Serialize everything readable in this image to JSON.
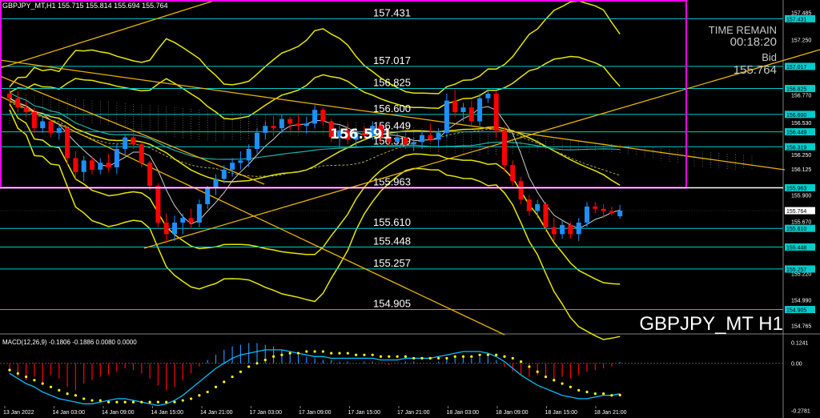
{
  "header": {
    "symbol_line": "GBPJPY_MT,H1  155.715 155.814 155.694 155.764"
  },
  "info": {
    "time_remain_label": "TIME REMAIN",
    "time_remain_value": "00:18:20",
    "bid_label": "Bid",
    "bid_value": "155.764",
    "watermark": "GBPJPY_MT H1",
    "center_price_tag": "156.591"
  },
  "colors": {
    "background": "#000000",
    "bull_candle": "#1e90ff",
    "bear_candle": "#ff0000",
    "level_line": "#00cccc",
    "trend_line": "#e8b400",
    "bollinger": "#e6e600",
    "box": "#ff00ff",
    "macd_line": "#00bfff",
    "macd_signal": "#ffff00"
  },
  "chart_data": [
    {
      "type": "candlestick",
      "instrument": "GBPJPY_MT",
      "timeframe": "H1",
      "ylim": [
        154.7,
        157.58
      ],
      "y_ticks": [
        "157.485",
        "157.250",
        "157.010",
        "156.770",
        "156.530",
        "156.250",
        "156.125",
        "155.900",
        "155.670",
        "155.440",
        "155.220",
        "154.990",
        "154.765"
      ],
      "x_ticks": [
        "13 Jan 2022",
        "14 Jan 03:00",
        "14 Jan 09:00",
        "14 Jan 15:00",
        "14 Jan 21:00",
        "17 Jan 03:00",
        "17 Jan 09:00",
        "17 Jan 15:00",
        "17 Jan 21:00",
        "18 Jan 03:00",
        "18 Jan 09:00",
        "18 Jan 15:00",
        "18 Jan 21:00"
      ],
      "levels": [
        157.431,
        157.017,
        156.825,
        156.6,
        156.449,
        156.319,
        155.963,
        155.61,
        155.448,
        155.257,
        154.905
      ],
      "level_labels": [
        "157.431",
        "157.017",
        "156.825",
        "156.600",
        "156.449",
        "156.319",
        "155.963",
        "155.610",
        "155.448",
        "155.257",
        "154.905"
      ],
      "level_tags": [
        "157.431",
        "157.017",
        "156.825",
        "156.600",
        "156.449",
        "156.319",
        "155.963",
        "155.610",
        "155.448",
        "155.257",
        "154.905"
      ],
      "current_price": 155.764,
      "current_price_tag": "155.764",
      "candles": [
        {
          "o": 156.78,
          "h": 156.84,
          "l": 156.7,
          "c": 156.74
        },
        {
          "o": 156.74,
          "h": 156.8,
          "l": 156.62,
          "c": 156.66
        },
        {
          "o": 156.66,
          "h": 156.72,
          "l": 156.58,
          "c": 156.62
        },
        {
          "o": 156.62,
          "h": 156.66,
          "l": 156.44,
          "c": 156.48
        },
        {
          "o": 156.48,
          "h": 156.58,
          "l": 156.44,
          "c": 156.54
        },
        {
          "o": 156.54,
          "h": 156.56,
          "l": 156.4,
          "c": 156.44
        },
        {
          "o": 156.44,
          "h": 156.52,
          "l": 156.38,
          "c": 156.48
        },
        {
          "o": 156.48,
          "h": 156.5,
          "l": 156.16,
          "c": 156.22
        },
        {
          "o": 156.22,
          "h": 156.28,
          "l": 156.04,
          "c": 156.1
        },
        {
          "o": 156.1,
          "h": 156.24,
          "l": 156.02,
          "c": 156.2
        },
        {
          "o": 156.2,
          "h": 156.24,
          "l": 156.08,
          "c": 156.12
        },
        {
          "o": 156.12,
          "h": 156.22,
          "l": 156.08,
          "c": 156.18
        },
        {
          "o": 156.18,
          "h": 156.26,
          "l": 156.1,
          "c": 156.14
        },
        {
          "o": 156.14,
          "h": 156.34,
          "l": 156.08,
          "c": 156.3
        },
        {
          "o": 156.3,
          "h": 156.42,
          "l": 156.24,
          "c": 156.4
        },
        {
          "o": 156.4,
          "h": 156.44,
          "l": 156.3,
          "c": 156.34
        },
        {
          "o": 156.34,
          "h": 156.36,
          "l": 156.14,
          "c": 156.18
        },
        {
          "o": 156.18,
          "h": 156.2,
          "l": 155.94,
          "c": 155.98
        },
        {
          "o": 155.98,
          "h": 156.0,
          "l": 155.62,
          "c": 155.66
        },
        {
          "o": 155.66,
          "h": 155.74,
          "l": 155.48,
          "c": 155.56
        },
        {
          "o": 155.56,
          "h": 155.72,
          "l": 155.5,
          "c": 155.66
        },
        {
          "o": 155.66,
          "h": 155.74,
          "l": 155.56,
          "c": 155.7
        },
        {
          "o": 155.7,
          "h": 155.78,
          "l": 155.6,
          "c": 155.66
        },
        {
          "o": 155.66,
          "h": 155.86,
          "l": 155.62,
          "c": 155.82
        },
        {
          "o": 155.82,
          "h": 155.98,
          "l": 155.78,
          "c": 155.96
        },
        {
          "o": 155.96,
          "h": 156.08,
          "l": 155.9,
          "c": 156.04
        },
        {
          "o": 156.04,
          "h": 156.16,
          "l": 156.0,
          "c": 156.12
        },
        {
          "o": 156.12,
          "h": 156.22,
          "l": 156.06,
          "c": 156.18
        },
        {
          "o": 156.18,
          "h": 156.28,
          "l": 156.12,
          "c": 156.2
        },
        {
          "o": 156.2,
          "h": 156.34,
          "l": 156.14,
          "c": 156.3
        },
        {
          "o": 156.3,
          "h": 156.48,
          "l": 156.26,
          "c": 156.44
        },
        {
          "o": 156.44,
          "h": 156.54,
          "l": 156.38,
          "c": 156.5
        },
        {
          "o": 156.5,
          "h": 156.58,
          "l": 156.42,
          "c": 156.48
        },
        {
          "o": 156.48,
          "h": 156.6,
          "l": 156.44,
          "c": 156.56
        },
        {
          "o": 156.56,
          "h": 156.58,
          "l": 156.46,
          "c": 156.52
        },
        {
          "o": 156.52,
          "h": 156.6,
          "l": 156.46,
          "c": 156.5
        },
        {
          "o": 156.5,
          "h": 156.58,
          "l": 156.44,
          "c": 156.52
        },
        {
          "o": 156.52,
          "h": 156.68,
          "l": 156.48,
          "c": 156.64
        },
        {
          "o": 156.64,
          "h": 156.66,
          "l": 156.5,
          "c": 156.54
        },
        {
          "o": 156.54,
          "h": 156.56,
          "l": 156.36,
          "c": 156.4
        },
        {
          "o": 156.4,
          "h": 156.5,
          "l": 156.32,
          "c": 156.46
        },
        {
          "o": 156.46,
          "h": 156.52,
          "l": 156.34,
          "c": 156.38
        },
        {
          "o": 156.38,
          "h": 156.48,
          "l": 156.32,
          "c": 156.44
        },
        {
          "o": 156.44,
          "h": 156.5,
          "l": 156.38,
          "c": 156.42
        },
        {
          "o": 156.42,
          "h": 156.54,
          "l": 156.38,
          "c": 156.5
        },
        {
          "o": 156.5,
          "h": 156.52,
          "l": 156.36,
          "c": 156.4
        },
        {
          "o": 156.4,
          "h": 156.46,
          "l": 156.32,
          "c": 156.36
        },
        {
          "o": 156.36,
          "h": 156.44,
          "l": 156.32,
          "c": 156.4
        },
        {
          "o": 156.4,
          "h": 156.44,
          "l": 156.3,
          "c": 156.34
        },
        {
          "o": 156.34,
          "h": 156.4,
          "l": 156.28,
          "c": 156.36
        },
        {
          "o": 156.36,
          "h": 156.46,
          "l": 156.3,
          "c": 156.42
        },
        {
          "o": 156.42,
          "h": 156.52,
          "l": 156.36,
          "c": 156.38
        },
        {
          "o": 156.38,
          "h": 156.48,
          "l": 156.32,
          "c": 156.44
        },
        {
          "o": 156.44,
          "h": 156.78,
          "l": 156.4,
          "c": 156.72
        },
        {
          "o": 156.72,
          "h": 156.82,
          "l": 156.58,
          "c": 156.62
        },
        {
          "o": 156.62,
          "h": 156.7,
          "l": 156.54,
          "c": 156.66
        },
        {
          "o": 156.66,
          "h": 156.72,
          "l": 156.5,
          "c": 156.54
        },
        {
          "o": 156.54,
          "h": 156.78,
          "l": 156.5,
          "c": 156.74
        },
        {
          "o": 156.74,
          "h": 156.82,
          "l": 156.7,
          "c": 156.78
        },
        {
          "o": 156.78,
          "h": 156.8,
          "l": 156.4,
          "c": 156.46
        },
        {
          "o": 156.46,
          "h": 156.5,
          "l": 156.1,
          "c": 156.16
        },
        {
          "o": 156.16,
          "h": 156.2,
          "l": 155.98,
          "c": 156.02
        },
        {
          "o": 156.02,
          "h": 156.06,
          "l": 155.82,
          "c": 155.86
        },
        {
          "o": 155.86,
          "h": 155.9,
          "l": 155.72,
          "c": 155.76
        },
        {
          "o": 155.76,
          "h": 155.86,
          "l": 155.7,
          "c": 155.82
        },
        {
          "o": 155.82,
          "h": 155.84,
          "l": 155.58,
          "c": 155.62
        },
        {
          "o": 155.62,
          "h": 155.7,
          "l": 155.5,
          "c": 155.56
        },
        {
          "o": 155.56,
          "h": 155.68,
          "l": 155.52,
          "c": 155.64
        },
        {
          "o": 155.64,
          "h": 155.66,
          "l": 155.52,
          "c": 155.56
        },
        {
          "o": 155.56,
          "h": 155.7,
          "l": 155.5,
          "c": 155.66
        },
        {
          "o": 155.66,
          "h": 155.84,
          "l": 155.62,
          "c": 155.8
        },
        {
          "o": 155.8,
          "h": 155.84,
          "l": 155.74,
          "c": 155.78
        },
        {
          "o": 155.78,
          "h": 155.82,
          "l": 155.7,
          "c": 155.76
        },
        {
          "o": 155.76,
          "h": 155.8,
          "l": 155.72,
          "c": 155.74
        },
        {
          "o": 155.715,
          "h": 155.814,
          "l": 155.694,
          "c": 155.764
        }
      ]
    },
    {
      "type": "bar",
      "indicator": "MACD(12,26,9)",
      "header": "MACD(12,26,9) -0.1806 -0.1886 0.0080 0.0000",
      "ylim": [
        -0.31,
        0.16
      ],
      "y_ticks": [
        "0.1241",
        "0.00",
        "-0.2781"
      ],
      "histogram": [
        -0.05,
        -0.08,
        -0.1,
        -0.08,
        -0.12,
        -0.07,
        -0.09,
        -0.14,
        -0.16,
        -0.12,
        -0.1,
        -0.08,
        -0.07,
        -0.05,
        -0.03,
        -0.04,
        -0.06,
        -0.09,
        -0.13,
        -0.16,
        -0.14,
        -0.1,
        -0.06,
        -0.02,
        0.02,
        0.05,
        0.08,
        0.1,
        0.11,
        0.12,
        0.12,
        0.11,
        0.1,
        0.08,
        0.07,
        0.05,
        0.04,
        0.03,
        0.02,
        0.02,
        0.01,
        0.01,
        0.0,
        0.01,
        0.01,
        0.0,
        -0.01,
        0.0,
        0.01,
        0.01,
        0.0,
        0.0,
        0.01,
        0.03,
        0.04,
        0.04,
        0.03,
        0.04,
        0.04,
        0.02,
        -0.02,
        -0.05,
        -0.07,
        -0.08,
        -0.07,
        -0.09,
        -0.1,
        -0.08,
        -0.09,
        -0.07,
        -0.05,
        -0.04,
        -0.03,
        -0.02,
        0.008
      ],
      "macd": [
        -0.06,
        -0.09,
        -0.12,
        -0.14,
        -0.17,
        -0.19,
        -0.21,
        -0.22,
        -0.23,
        -0.24,
        -0.24,
        -0.23,
        -0.22,
        -0.21,
        -0.21,
        -0.22,
        -0.23,
        -0.24,
        -0.25,
        -0.24,
        -0.22,
        -0.19,
        -0.15,
        -0.11,
        -0.07,
        -0.03,
        0.0,
        0.03,
        0.05,
        0.06,
        0.07,
        0.08,
        0.08,
        0.08,
        0.07,
        0.06,
        0.05,
        0.04,
        0.04,
        0.03,
        0.03,
        0.03,
        0.03,
        0.03,
        0.03,
        0.02,
        0.02,
        0.02,
        0.03,
        0.03,
        0.03,
        0.03,
        0.04,
        0.05,
        0.06,
        0.07,
        0.07,
        0.07,
        0.06,
        0.04,
        0.01,
        -0.03,
        -0.07,
        -0.1,
        -0.13,
        -0.15,
        -0.17,
        -0.19,
        -0.2,
        -0.21,
        -0.21,
        -0.2,
        -0.19,
        -0.19,
        -0.1806
      ],
      "signal": [
        -0.04,
        -0.06,
        -0.08,
        -0.1,
        -0.12,
        -0.14,
        -0.16,
        -0.18,
        -0.19,
        -0.21,
        -0.22,
        -0.22,
        -0.23,
        -0.23,
        -0.23,
        -0.23,
        -0.23,
        -0.23,
        -0.23,
        -0.23,
        -0.23,
        -0.22,
        -0.21,
        -0.19,
        -0.17,
        -0.14,
        -0.11,
        -0.08,
        -0.05,
        -0.02,
        0.0,
        0.02,
        0.04,
        0.05,
        0.06,
        0.06,
        0.07,
        0.07,
        0.07,
        0.06,
        0.06,
        0.06,
        0.05,
        0.05,
        0.05,
        0.04,
        0.04,
        0.04,
        0.04,
        0.03,
        0.03,
        0.03,
        0.03,
        0.03,
        0.04,
        0.04,
        0.04,
        0.05,
        0.05,
        0.05,
        0.04,
        0.03,
        0.01,
        -0.02,
        -0.05,
        -0.08,
        -0.1,
        -0.12,
        -0.14,
        -0.16,
        -0.17,
        -0.18,
        -0.18,
        -0.19,
        -0.1886
      ]
    }
  ]
}
